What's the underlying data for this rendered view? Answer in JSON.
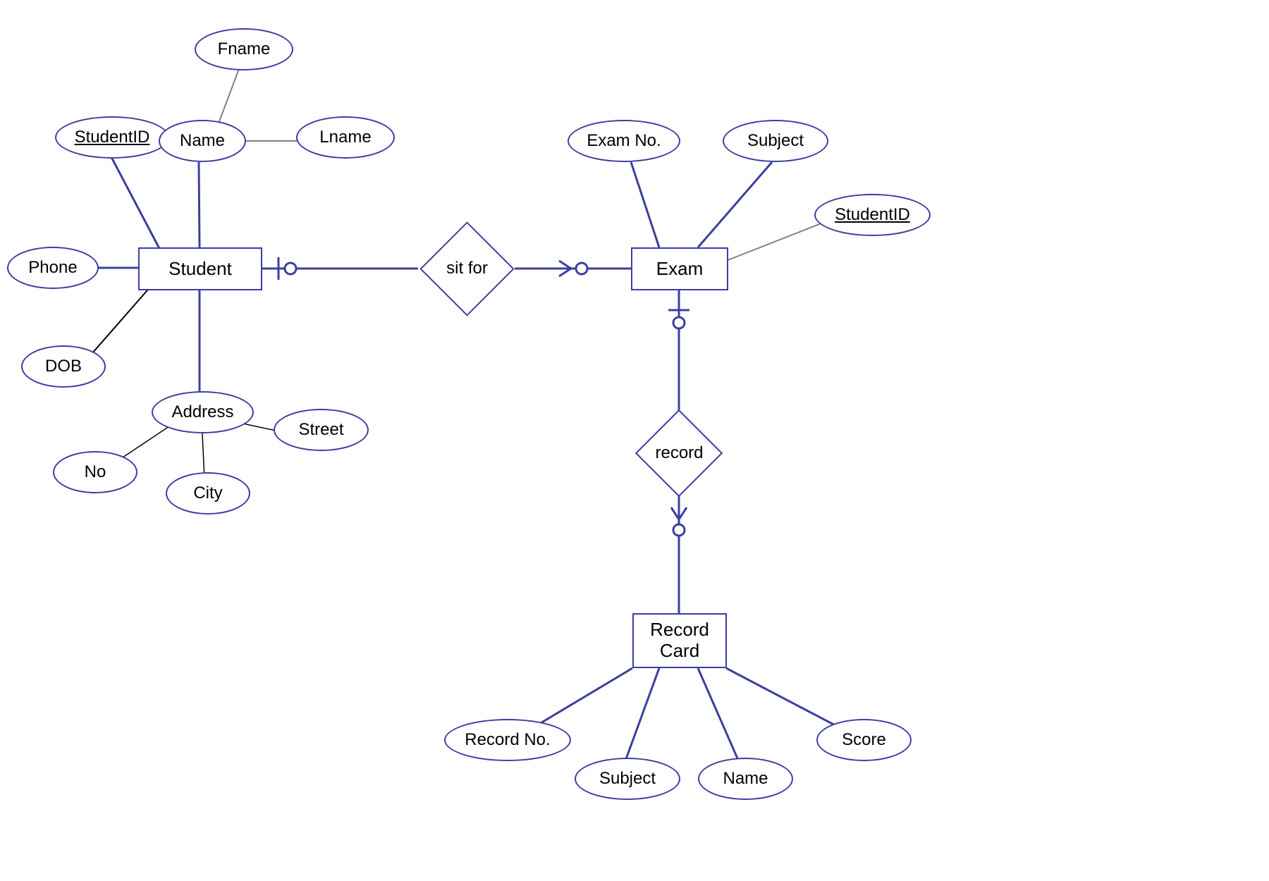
{
  "entities": {
    "student": "Student",
    "exam": "Exam",
    "recordCard": "Record\nCard"
  },
  "relationships": {
    "sitFor": "sit for",
    "record": "record"
  },
  "attributes": {
    "studentId": "StudentID",
    "name": "Name",
    "fname": "Fname",
    "lname": "Lname",
    "phone": "Phone",
    "dob": "DOB",
    "address": "Address",
    "no": "No",
    "city": "City",
    "street": "Street",
    "examNo": "Exam No.",
    "subjectExam": "Subject",
    "studentIdExam": "StudentID",
    "recordNo": "Record No.",
    "subjectRec": "Subject",
    "nameRec": "Name",
    "score": "Score"
  }
}
